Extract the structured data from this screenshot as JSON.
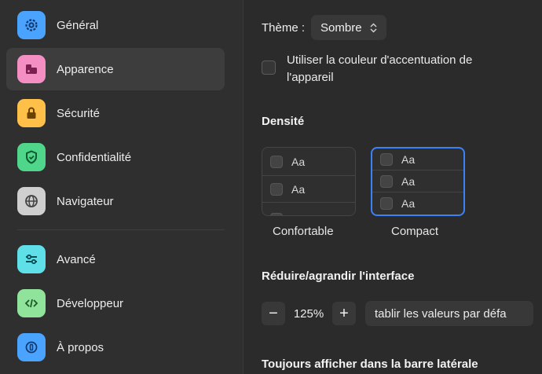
{
  "sidebar": {
    "items": [
      {
        "label": "Général",
        "icon": "gear-icon",
        "color": "#4aa3ff"
      },
      {
        "label": "Apparence",
        "icon": "palette-icon",
        "color": "#f48fc4",
        "active": true
      },
      {
        "label": "Sécurité",
        "icon": "lock-icon",
        "color": "#ffc04a"
      },
      {
        "label": "Confidentialité",
        "icon": "shield-icon",
        "color": "#4fd68a"
      },
      {
        "label": "Navigateur",
        "icon": "globe-icon",
        "color": "#cfcfcf"
      },
      {
        "label": "Avancé",
        "icon": "sliders-icon",
        "color": "#5fe0e8"
      },
      {
        "label": "Développeur",
        "icon": "code-icon",
        "color": "#8fe39a"
      },
      {
        "label": "À propos",
        "icon": "info-icon",
        "color": "#4aa3ff"
      }
    ]
  },
  "theme": {
    "label": "Thème :",
    "value": "Sombre"
  },
  "accent": {
    "label": "Utiliser la couleur d'accentuation de l'appareil"
  },
  "density": {
    "title": "Densité",
    "sample": "Aa",
    "options": [
      {
        "label": "Confortable",
        "selected": false
      },
      {
        "label": "Compact",
        "selected": true
      }
    ]
  },
  "zoom": {
    "title": "Réduire/agrandir l'interface",
    "minus": "−",
    "plus": "+",
    "value": "125%",
    "reset_label": "tablir les valeurs par défa"
  },
  "sidebar_section": {
    "title": "Toujours afficher dans la barre latérale"
  },
  "accent_color": "#3b82f6"
}
